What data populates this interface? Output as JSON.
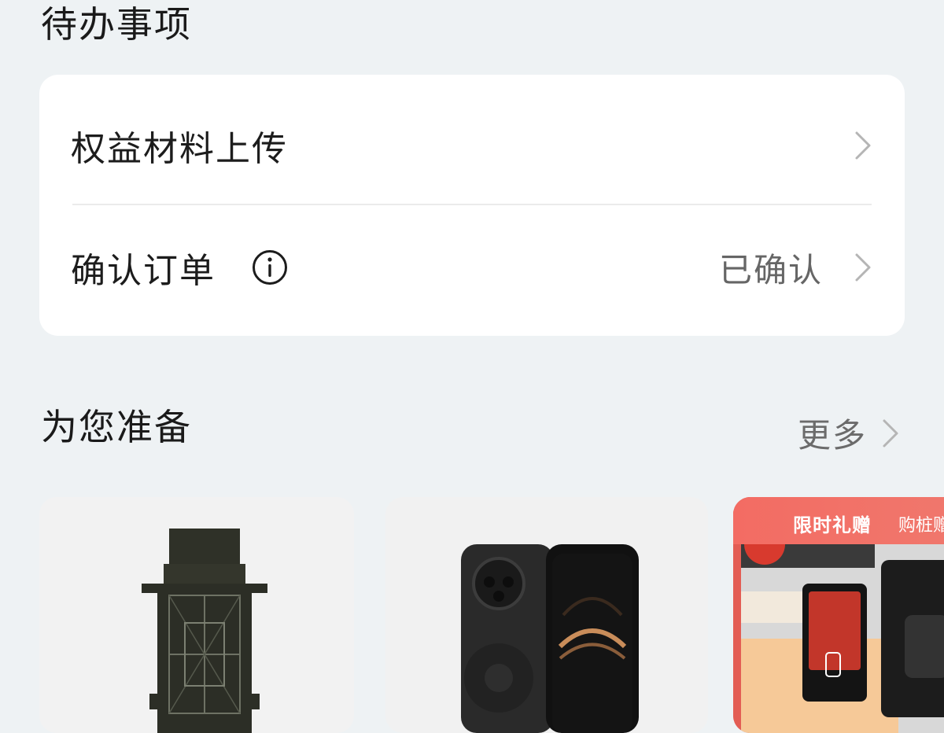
{
  "todo": {
    "title": "待办事项",
    "items": [
      {
        "label": "权益材料上传"
      },
      {
        "label": "确认订单",
        "status": "已确认"
      }
    ]
  },
  "prepare": {
    "title": "为您准备",
    "more_label": "更多"
  },
  "products": [
    {
      "name": "chassis-protector-product"
    },
    {
      "name": "smartphone-product"
    },
    {
      "name": "charging-pile-promo",
      "tag": "限时礼赠",
      "tag2": "购桩赠"
    }
  ],
  "colors": {
    "background": "#eef2f4",
    "card": "#ffffff",
    "promo_red": "#e9584f"
  }
}
